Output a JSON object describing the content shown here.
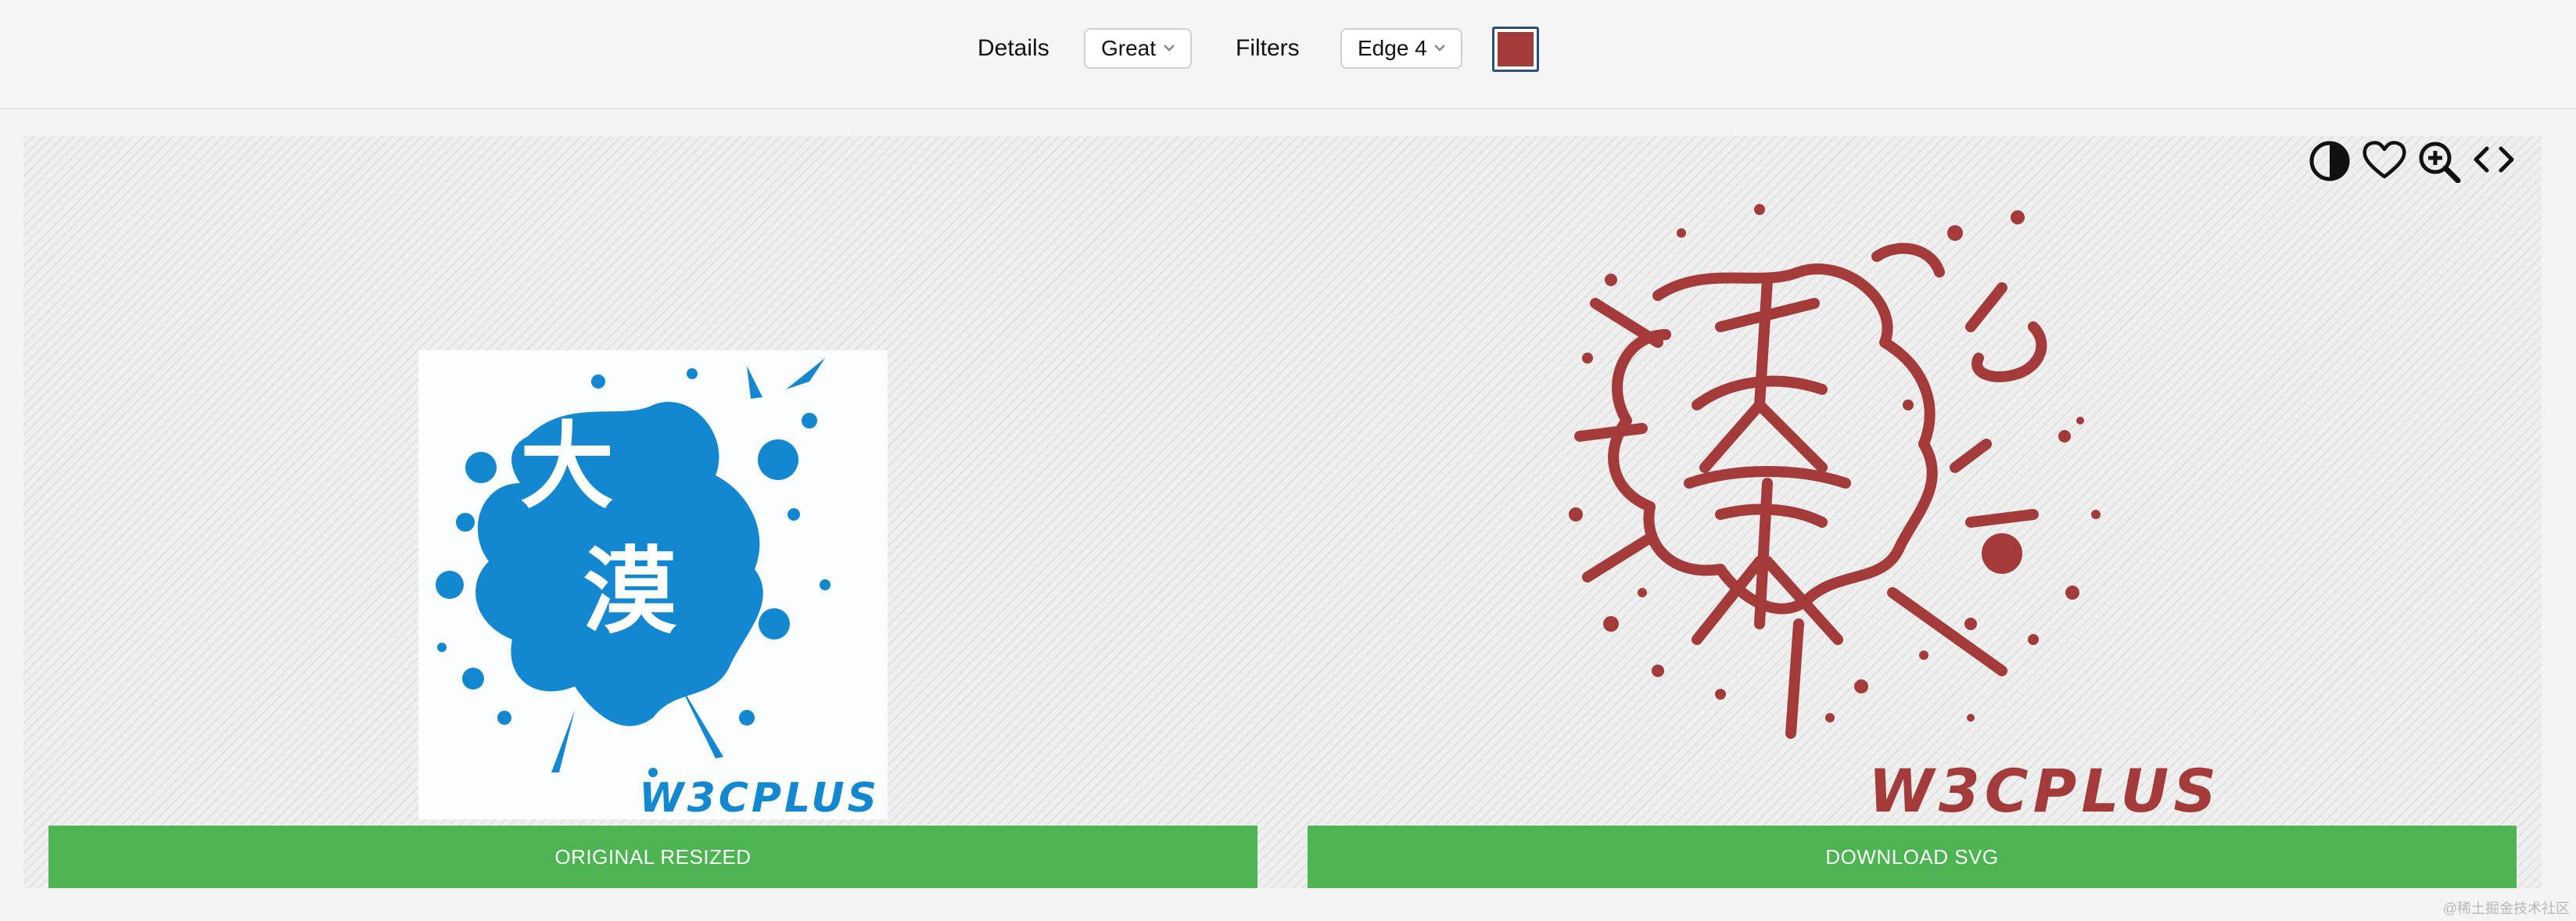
{
  "toolbar": {
    "details_label": "Details",
    "details_value": "Great",
    "filters_label": "Filters",
    "filters_value": "Edge 4",
    "selected_color": "#a33b3b"
  },
  "icons": [
    "contrast-icon",
    "heart-icon",
    "zoom-in-icon",
    "code-icon"
  ],
  "original_image": {
    "text_main": "大漠",
    "text_brand": "W3CPLUS",
    "color": "#1387cf"
  },
  "svg_output": {
    "text_main": "大漠",
    "text_brand": "W3CPLUS",
    "color": "#a33b3b"
  },
  "buttons": {
    "original_label": "ORIGINAL RESIZED",
    "download_label": "DOWNLOAD SVG",
    "color": "#4cb450"
  },
  "watermark": "@稀土掘金技术社区"
}
